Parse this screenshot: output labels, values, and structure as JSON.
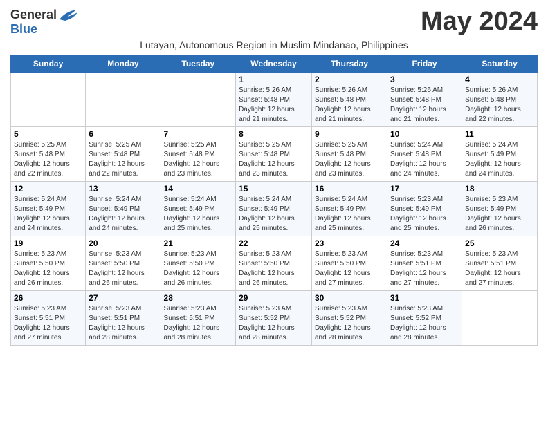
{
  "header": {
    "logo_general": "General",
    "logo_blue": "Blue",
    "month_title": "May 2024",
    "subtitle": "Lutayan, Autonomous Region in Muslim Mindanao, Philippines"
  },
  "days_of_week": [
    "Sunday",
    "Monday",
    "Tuesday",
    "Wednesday",
    "Thursday",
    "Friday",
    "Saturday"
  ],
  "weeks": [
    [
      {
        "day": "",
        "text": ""
      },
      {
        "day": "",
        "text": ""
      },
      {
        "day": "",
        "text": ""
      },
      {
        "day": "1",
        "text": "Sunrise: 5:26 AM\nSunset: 5:48 PM\nDaylight: 12 hours\nand 21 minutes."
      },
      {
        "day": "2",
        "text": "Sunrise: 5:26 AM\nSunset: 5:48 PM\nDaylight: 12 hours\nand 21 minutes."
      },
      {
        "day": "3",
        "text": "Sunrise: 5:26 AM\nSunset: 5:48 PM\nDaylight: 12 hours\nand 21 minutes."
      },
      {
        "day": "4",
        "text": "Sunrise: 5:26 AM\nSunset: 5:48 PM\nDaylight: 12 hours\nand 22 minutes."
      }
    ],
    [
      {
        "day": "5",
        "text": "Sunrise: 5:25 AM\nSunset: 5:48 PM\nDaylight: 12 hours\nand 22 minutes."
      },
      {
        "day": "6",
        "text": "Sunrise: 5:25 AM\nSunset: 5:48 PM\nDaylight: 12 hours\nand 22 minutes."
      },
      {
        "day": "7",
        "text": "Sunrise: 5:25 AM\nSunset: 5:48 PM\nDaylight: 12 hours\nand 23 minutes."
      },
      {
        "day": "8",
        "text": "Sunrise: 5:25 AM\nSunset: 5:48 PM\nDaylight: 12 hours\nand 23 minutes."
      },
      {
        "day": "9",
        "text": "Sunrise: 5:25 AM\nSunset: 5:48 PM\nDaylight: 12 hours\nand 23 minutes."
      },
      {
        "day": "10",
        "text": "Sunrise: 5:24 AM\nSunset: 5:48 PM\nDaylight: 12 hours\nand 24 minutes."
      },
      {
        "day": "11",
        "text": "Sunrise: 5:24 AM\nSunset: 5:49 PM\nDaylight: 12 hours\nand 24 minutes."
      }
    ],
    [
      {
        "day": "12",
        "text": "Sunrise: 5:24 AM\nSunset: 5:49 PM\nDaylight: 12 hours\nand 24 minutes."
      },
      {
        "day": "13",
        "text": "Sunrise: 5:24 AM\nSunset: 5:49 PM\nDaylight: 12 hours\nand 24 minutes."
      },
      {
        "day": "14",
        "text": "Sunrise: 5:24 AM\nSunset: 5:49 PM\nDaylight: 12 hours\nand 25 minutes."
      },
      {
        "day": "15",
        "text": "Sunrise: 5:24 AM\nSunset: 5:49 PM\nDaylight: 12 hours\nand 25 minutes."
      },
      {
        "day": "16",
        "text": "Sunrise: 5:24 AM\nSunset: 5:49 PM\nDaylight: 12 hours\nand 25 minutes."
      },
      {
        "day": "17",
        "text": "Sunrise: 5:23 AM\nSunset: 5:49 PM\nDaylight: 12 hours\nand 25 minutes."
      },
      {
        "day": "18",
        "text": "Sunrise: 5:23 AM\nSunset: 5:49 PM\nDaylight: 12 hours\nand 26 minutes."
      }
    ],
    [
      {
        "day": "19",
        "text": "Sunrise: 5:23 AM\nSunset: 5:50 PM\nDaylight: 12 hours\nand 26 minutes."
      },
      {
        "day": "20",
        "text": "Sunrise: 5:23 AM\nSunset: 5:50 PM\nDaylight: 12 hours\nand 26 minutes."
      },
      {
        "day": "21",
        "text": "Sunrise: 5:23 AM\nSunset: 5:50 PM\nDaylight: 12 hours\nand 26 minutes."
      },
      {
        "day": "22",
        "text": "Sunrise: 5:23 AM\nSunset: 5:50 PM\nDaylight: 12 hours\nand 26 minutes."
      },
      {
        "day": "23",
        "text": "Sunrise: 5:23 AM\nSunset: 5:50 PM\nDaylight: 12 hours\nand 27 minutes."
      },
      {
        "day": "24",
        "text": "Sunrise: 5:23 AM\nSunset: 5:51 PM\nDaylight: 12 hours\nand 27 minutes."
      },
      {
        "day": "25",
        "text": "Sunrise: 5:23 AM\nSunset: 5:51 PM\nDaylight: 12 hours\nand 27 minutes."
      }
    ],
    [
      {
        "day": "26",
        "text": "Sunrise: 5:23 AM\nSunset: 5:51 PM\nDaylight: 12 hours\nand 27 minutes."
      },
      {
        "day": "27",
        "text": "Sunrise: 5:23 AM\nSunset: 5:51 PM\nDaylight: 12 hours\nand 28 minutes."
      },
      {
        "day": "28",
        "text": "Sunrise: 5:23 AM\nSunset: 5:51 PM\nDaylight: 12 hours\nand 28 minutes."
      },
      {
        "day": "29",
        "text": "Sunrise: 5:23 AM\nSunset: 5:52 PM\nDaylight: 12 hours\nand 28 minutes."
      },
      {
        "day": "30",
        "text": "Sunrise: 5:23 AM\nSunset: 5:52 PM\nDaylight: 12 hours\nand 28 minutes."
      },
      {
        "day": "31",
        "text": "Sunrise: 5:23 AM\nSunset: 5:52 PM\nDaylight: 12 hours\nand 28 minutes."
      },
      {
        "day": "",
        "text": ""
      }
    ]
  ]
}
